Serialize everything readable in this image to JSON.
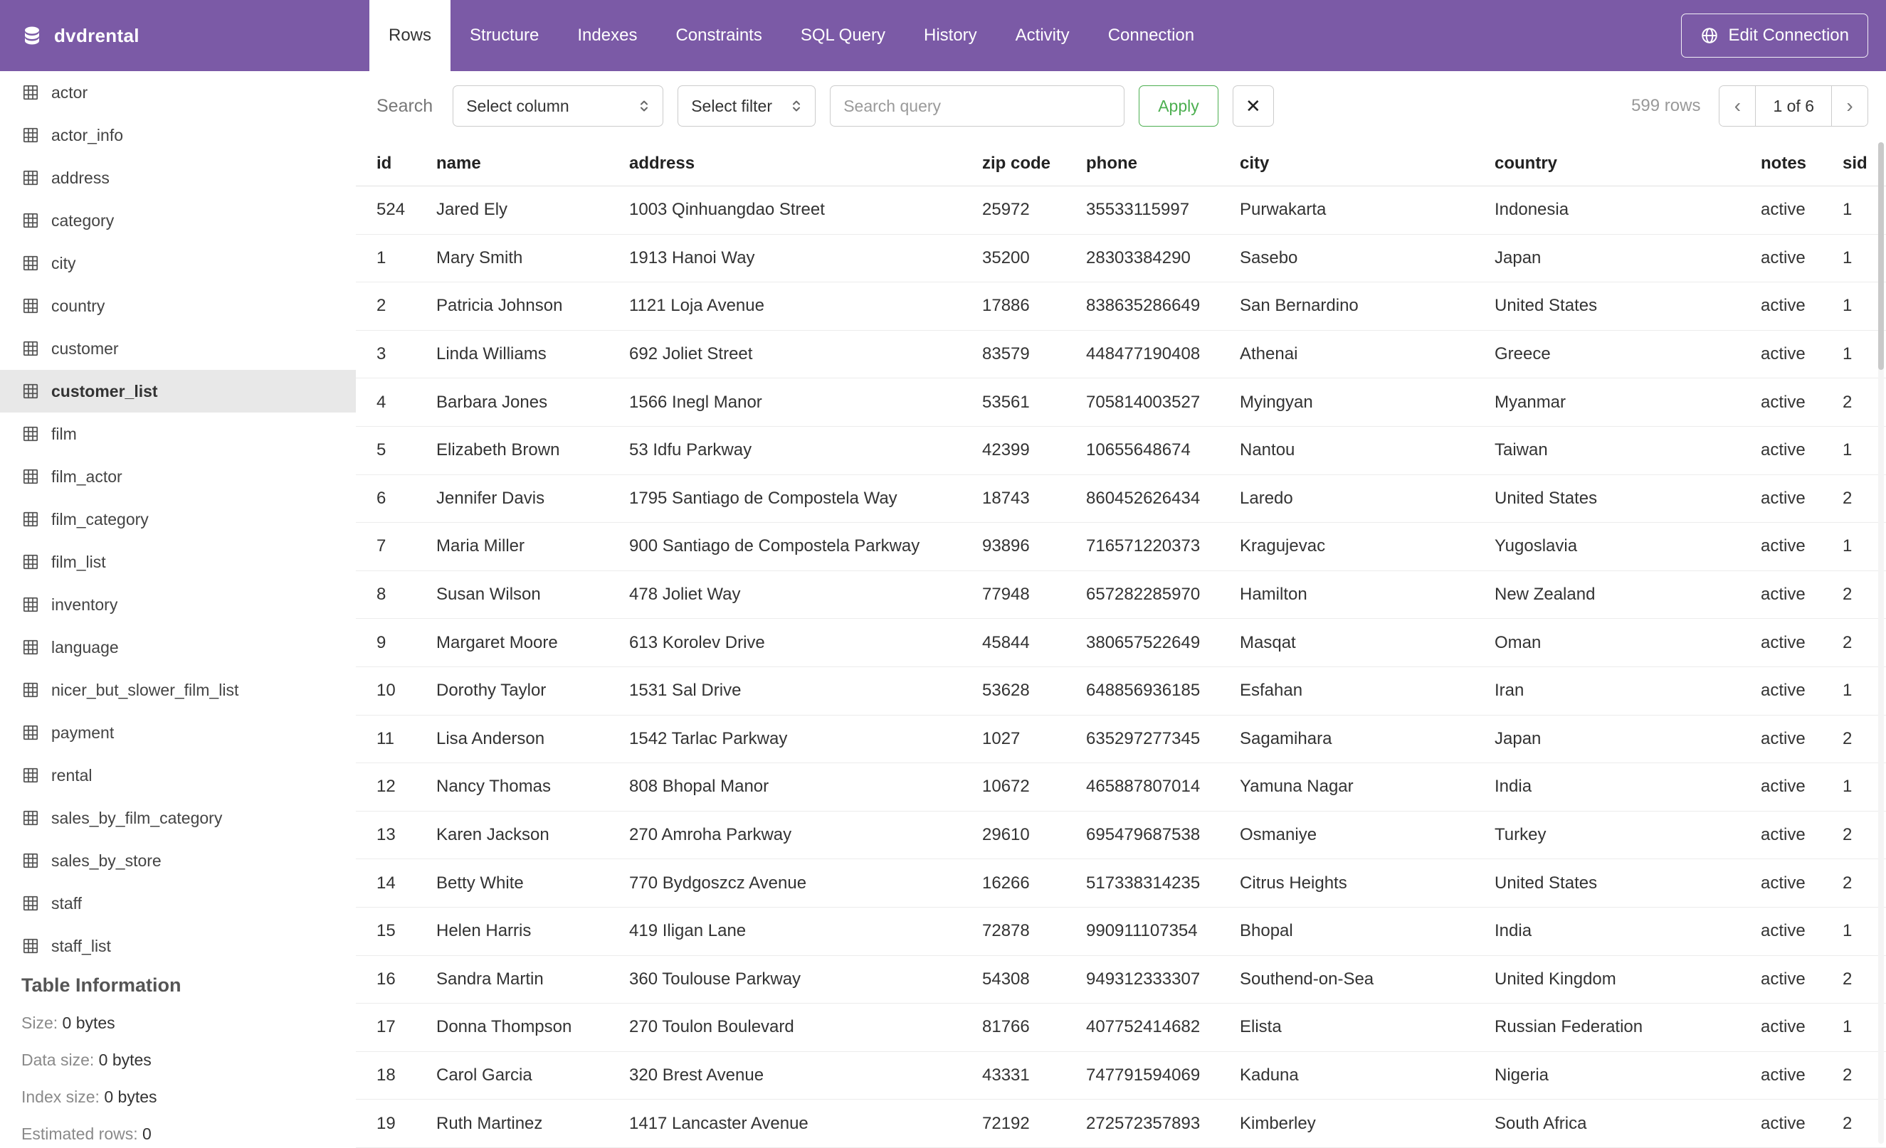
{
  "app": {
    "database_name": "dvdrental",
    "edit_connection_label": "Edit Connection"
  },
  "tabs": [
    {
      "label": "Rows",
      "active": true
    },
    {
      "label": "Structure",
      "active": false
    },
    {
      "label": "Indexes",
      "active": false
    },
    {
      "label": "Constraints",
      "active": false
    },
    {
      "label": "SQL Query",
      "active": false
    },
    {
      "label": "History",
      "active": false
    },
    {
      "label": "Activity",
      "active": false
    },
    {
      "label": "Connection",
      "active": false
    }
  ],
  "sidebar": {
    "tables": [
      "actor",
      "actor_info",
      "address",
      "category",
      "city",
      "country",
      "customer",
      "customer_list",
      "film",
      "film_actor",
      "film_category",
      "film_list",
      "inventory",
      "language",
      "nicer_but_slower_film_list",
      "payment",
      "rental",
      "sales_by_film_category",
      "sales_by_store",
      "staff",
      "staff_list"
    ],
    "selected": "customer_list",
    "table_information": {
      "heading": "Table Information",
      "size_label": "Size:",
      "size_value": "0 bytes",
      "data_size_label": "Data size:",
      "data_size_value": "0 bytes",
      "index_size_label": "Index size:",
      "index_size_value": "0 bytes",
      "estimated_rows_label": "Estimated rows:",
      "estimated_rows_value": "0"
    }
  },
  "toolbar": {
    "search_label": "Search",
    "select_column_placeholder": "Select column",
    "select_filter_placeholder": "Select filter",
    "search_query_placeholder": "Search query",
    "apply_label": "Apply",
    "clear_label": "✕",
    "rows_count": "599 rows",
    "prev_label": "‹",
    "page_indicator": "1 of 6",
    "next_label": "›"
  },
  "table": {
    "columns": [
      "id",
      "name",
      "address",
      "zip code",
      "phone",
      "city",
      "country",
      "notes",
      "sid"
    ],
    "rows": [
      [
        "524",
        "Jared Ely",
        "1003 Qinhuangdao Street",
        "25972",
        "35533115997",
        "Purwakarta",
        "Indonesia",
        "active",
        "1"
      ],
      [
        "1",
        "Mary Smith",
        "1913 Hanoi Way",
        "35200",
        "28303384290",
        "Sasebo",
        "Japan",
        "active",
        "1"
      ],
      [
        "2",
        "Patricia Johnson",
        "1121 Loja Avenue",
        "17886",
        "838635286649",
        "San Bernardino",
        "United States",
        "active",
        "1"
      ],
      [
        "3",
        "Linda Williams",
        "692 Joliet Street",
        "83579",
        "448477190408",
        "Athenai",
        "Greece",
        "active",
        "1"
      ],
      [
        "4",
        "Barbara Jones",
        "1566 Inegl Manor",
        "53561",
        "705814003527",
        "Myingyan",
        "Myanmar",
        "active",
        "2"
      ],
      [
        "5",
        "Elizabeth Brown",
        "53 Idfu Parkway",
        "42399",
        "10655648674",
        "Nantou",
        "Taiwan",
        "active",
        "1"
      ],
      [
        "6",
        "Jennifer Davis",
        "1795 Santiago de Compostela Way",
        "18743",
        "860452626434",
        "Laredo",
        "United States",
        "active",
        "2"
      ],
      [
        "7",
        "Maria Miller",
        "900 Santiago de Compostela Parkway",
        "93896",
        "716571220373",
        "Kragujevac",
        "Yugoslavia",
        "active",
        "1"
      ],
      [
        "8",
        "Susan Wilson",
        "478 Joliet Way",
        "77948",
        "657282285970",
        "Hamilton",
        "New Zealand",
        "active",
        "2"
      ],
      [
        "9",
        "Margaret Moore",
        "613 Korolev Drive",
        "45844",
        "380657522649",
        "Masqat",
        "Oman",
        "active",
        "2"
      ],
      [
        "10",
        "Dorothy Taylor",
        "1531 Sal Drive",
        "53628",
        "648856936185",
        "Esfahan",
        "Iran",
        "active",
        "1"
      ],
      [
        "11",
        "Lisa Anderson",
        "1542 Tarlac Parkway",
        "1027",
        "635297277345",
        "Sagamihara",
        "Japan",
        "active",
        "2"
      ],
      [
        "12",
        "Nancy Thomas",
        "808 Bhopal Manor",
        "10672",
        "465887807014",
        "Yamuna Nagar",
        "India",
        "active",
        "1"
      ],
      [
        "13",
        "Karen Jackson",
        "270 Amroha Parkway",
        "29610",
        "695479687538",
        "Osmaniye",
        "Turkey",
        "active",
        "2"
      ],
      [
        "14",
        "Betty White",
        "770 Bydgoszcz Avenue",
        "16266",
        "517338314235",
        "Citrus Heights",
        "United States",
        "active",
        "2"
      ],
      [
        "15",
        "Helen Harris",
        "419 Iligan Lane",
        "72878",
        "990911107354",
        "Bhopal",
        "India",
        "active",
        "1"
      ],
      [
        "16",
        "Sandra Martin",
        "360 Toulouse Parkway",
        "54308",
        "949312333307",
        "Southend-on-Sea",
        "United Kingdom",
        "active",
        "2"
      ],
      [
        "17",
        "Donna Thompson",
        "270 Toulon Boulevard",
        "81766",
        "407752414682",
        "Elista",
        "Russian Federation",
        "active",
        "1"
      ],
      [
        "18",
        "Carol Garcia",
        "320 Brest Avenue",
        "43331",
        "747791594069",
        "Kaduna",
        "Nigeria",
        "active",
        "2"
      ],
      [
        "19",
        "Ruth Martinez",
        "1417 Lancaster Avenue",
        "72192",
        "272572357893",
        "Kimberley",
        "South Africa",
        "active",
        "2"
      ]
    ]
  },
  "colors": {
    "accent": "#7B5AA6",
    "green": "#4CAF50",
    "border": "#cccccc",
    "row-border": "#ececec",
    "text": "#333333",
    "muted": "#8a8a8a",
    "selected-bg": "#e8e8e8"
  }
}
